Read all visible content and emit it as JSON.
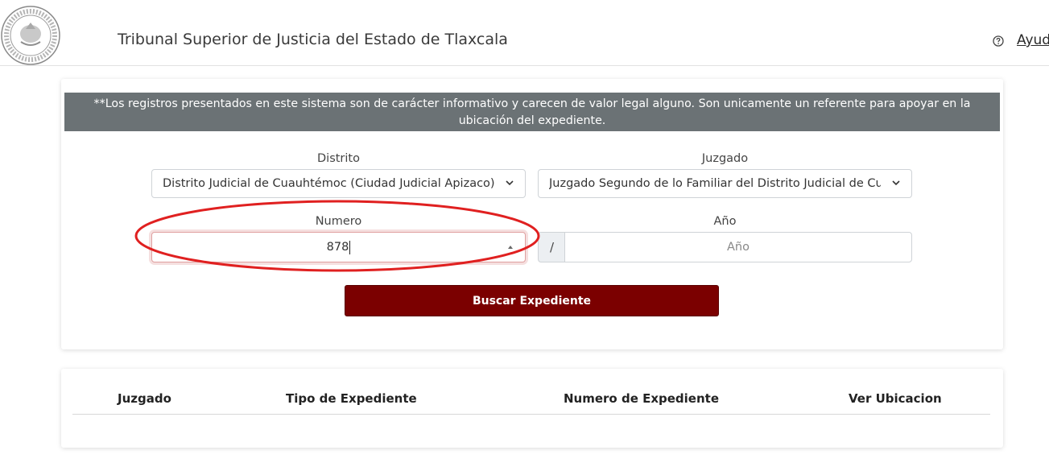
{
  "header": {
    "title": "Tribunal Superior de Justicia del Estado de Tlaxcala",
    "help_label": "Ayuda",
    "logo_icon": "court-seal-icon",
    "help_icon": "question-circle-icon"
  },
  "search": {
    "notice": "**Los registros presentados en este sistema son de carácter informativo y carecen de valor legal alguno. Son unicamente un referente para apoyar en la ubicación del expediente.",
    "district_label": "Distrito",
    "district_value": "Distrito Judicial de Cuauhtémoc (Ciudad Judicial Apizaco)",
    "court_label": "Juzgado",
    "court_value": "Juzgado Segundo de lo Familiar del Distrito Judicial de Cuauhtémoc",
    "number_label": "Numero",
    "number_value": "878",
    "separator": "/",
    "year_label": "Año",
    "year_placeholder": "Año",
    "submit_label": "Buscar Expediente"
  },
  "results": {
    "columns": [
      "Juzgado",
      "Tipo de Expediente",
      "Numero de Expediente",
      "Ver Ubicacion"
    ]
  },
  "colors": {
    "banner": "#6b7275",
    "button": "#7b0000",
    "annotation": "#e02020"
  }
}
